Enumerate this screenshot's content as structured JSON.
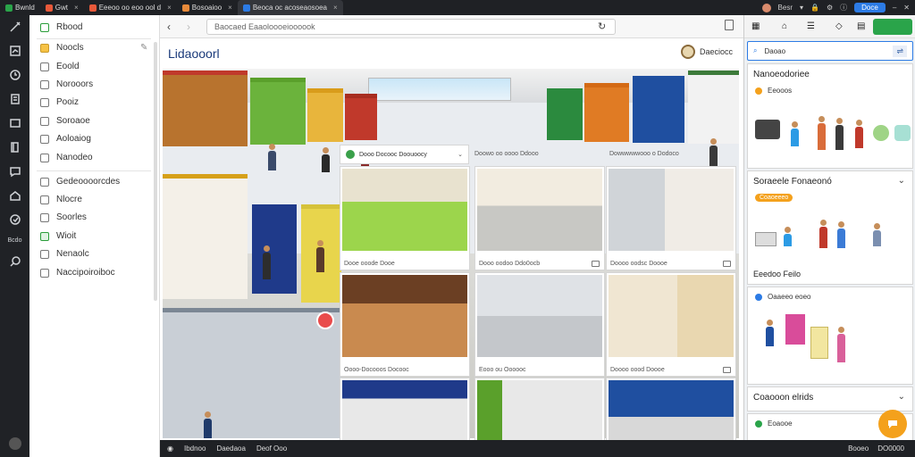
{
  "tabs": [
    {
      "label": "Bwnld"
    },
    {
      "label": "Gwt"
    },
    {
      "label": "Eeeoo oo eoo ool d"
    },
    {
      "label": "Bosoaioo"
    },
    {
      "label": "Beoca oc acoseaosoea"
    }
  ],
  "topbar": {
    "profile_label": "Besr",
    "button_label": "Doce"
  },
  "rail": {
    "bottom_label": "Bcdo"
  },
  "sidebar": {
    "items": [
      {
        "label": "Rbood"
      },
      {
        "label": "Noocls"
      },
      {
        "label": "Eoold"
      },
      {
        "label": "Norooors"
      },
      {
        "label": "Pooiz"
      },
      {
        "label": "Soroaoe"
      },
      {
        "label": "Aoloaiog"
      },
      {
        "label": "Nanodeo"
      },
      {
        "label": "Gedeoooorcdes"
      },
      {
        "label": "Nlocre"
      },
      {
        "label": "Soorles"
      },
      {
        "label": "Wioit"
      },
      {
        "label": "Nenaolc"
      },
      {
        "label": "Naccipoiroiboc"
      }
    ]
  },
  "address": {
    "url": "Baocaed Eaaoloooeioooook"
  },
  "page": {
    "title": "Lidaooorl",
    "user_label": "Daeciocc"
  },
  "grid": {
    "category_label": "Dooo Docooc Doouoocy",
    "meta_top": [
      {
        "text": "Dowwwwwooo o Dodoco"
      },
      {
        "text": "Doowo oo oooo Ddooo"
      }
    ],
    "cards": [
      {
        "caption": "Dooe ooode Dooe"
      },
      {
        "caption": "Dooo oodoo Ddo0ocb"
      },
      {
        "caption": "Doooo oodsc Doooe"
      },
      {
        "caption": "Oooo-Docooos Docooc"
      },
      {
        "caption": "Eooo ou Oooooc"
      },
      {
        "caption": "Doooo oood Doooe"
      }
    ]
  },
  "status": {
    "left": "Ibdnoo",
    "left2": "Daedaoa",
    "left3": "Deof Ooo",
    "right": "Booeo",
    "right2": "DO0000"
  },
  "rpanel": {
    "search_value": "Daoao",
    "sections": [
      {
        "title": "Nanoeodoriee",
        "sub": "Eeooos"
      },
      {
        "title": "Soraeele Fonaeonó",
        "sub": "Coaoeeeo",
        "footer": "Eeedoo Feilo"
      },
      {
        "title": "",
        "sub": "Oaaeeo eoeo"
      },
      {
        "title": "Coaooon elrids",
        "sub": "Eoaooe"
      }
    ]
  },
  "colors": {
    "accent": "#2c7be5",
    "dark": "#1f2125",
    "brand_green": "#2aa44a",
    "fab": "#f4a11c"
  }
}
